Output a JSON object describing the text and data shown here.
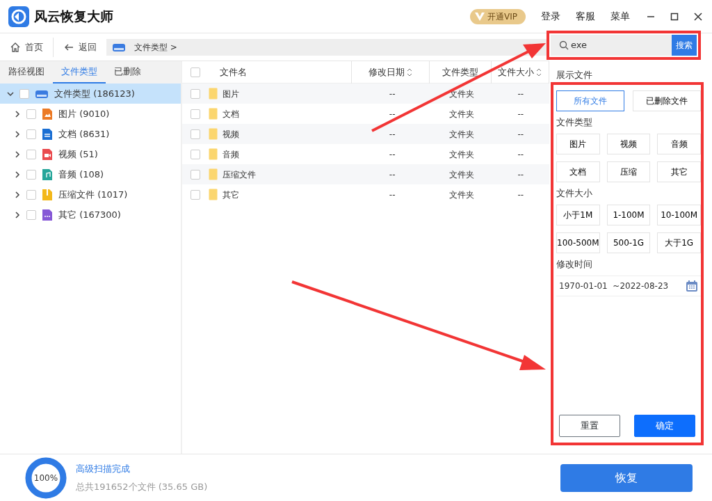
{
  "app": {
    "title": "风云恢复大师"
  },
  "header": {
    "vip": "开通VIP",
    "links": [
      "登录",
      "客服",
      "菜单"
    ]
  },
  "toolbar": {
    "home": "首页",
    "back": "返回",
    "breadcrumb": "文件类型 >"
  },
  "search": {
    "value": "exe",
    "button": "搜索"
  },
  "left_tabs": [
    {
      "label": "路径视图",
      "selected": false
    },
    {
      "label": "文件类型",
      "selected": true
    },
    {
      "label": "已删除",
      "selected": false
    }
  ],
  "tree": {
    "label": "文件类型 (186123)",
    "selected": true,
    "expanded": true,
    "checked": false,
    "children": [
      {
        "label": "图片 (9010)",
        "kind": "image",
        "expanded": false,
        "checked": false
      },
      {
        "label": "文档 (8631)",
        "kind": "document",
        "expanded": false,
        "checked": false
      },
      {
        "label": "视频 (51)",
        "kind": "video",
        "expanded": false,
        "checked": false
      },
      {
        "label": "音频 (108)",
        "kind": "audio",
        "expanded": false,
        "checked": false
      },
      {
        "label": "压缩文件 (1017)",
        "kind": "archive",
        "expanded": false,
        "checked": false
      },
      {
        "label": "其它 (167300)",
        "kind": "other",
        "expanded": false,
        "checked": false
      }
    ]
  },
  "table": {
    "all_checked": false,
    "columns": [
      {
        "label": "文件名",
        "sortable": false
      },
      {
        "label": "修改日期",
        "sortable": true
      },
      {
        "label": "文件类型",
        "sortable": false
      },
      {
        "label": "文件大小",
        "sortable": true
      }
    ],
    "rows": [
      {
        "name": "图片",
        "date": "--",
        "type": "文件夹",
        "size": "--",
        "checked": false
      },
      {
        "name": "文档",
        "date": "--",
        "type": "文件夹",
        "size": "--",
        "checked": false
      },
      {
        "name": "视频",
        "date": "--",
        "type": "文件夹",
        "size": "--",
        "checked": false
      },
      {
        "name": "音频",
        "date": "--",
        "type": "文件夹",
        "size": "--",
        "checked": false
      },
      {
        "name": "压缩文件",
        "date": "--",
        "type": "文件夹",
        "size": "--",
        "checked": false
      },
      {
        "name": "其它",
        "date": "--",
        "type": "文件夹",
        "size": "--",
        "checked": false
      }
    ]
  },
  "filter": {
    "show_title": "展示文件",
    "show_options": [
      {
        "label": "所有文件",
        "selected": true
      },
      {
        "label": "已删除文件",
        "selected": false
      }
    ],
    "type_title": "文件类型",
    "types": [
      "图片",
      "视频",
      "音频",
      "文档",
      "压缩",
      "其它"
    ],
    "size_title": "文件大小",
    "sizes": [
      "小于1M",
      "1-100M",
      "10-100M",
      "100-500M",
      "500-1G",
      "大于1G"
    ],
    "time_title": "修改时间",
    "date_range": "1970-01-01  ~2022-08-23",
    "reset": "重置",
    "confirm": "确定"
  },
  "footer": {
    "progress": {
      "level": 1.0,
      "reading": "100%"
    },
    "status": "高级扫描完成",
    "summary": "总共191652个文件 (35.65 GB)",
    "recover": "恢复"
  }
}
